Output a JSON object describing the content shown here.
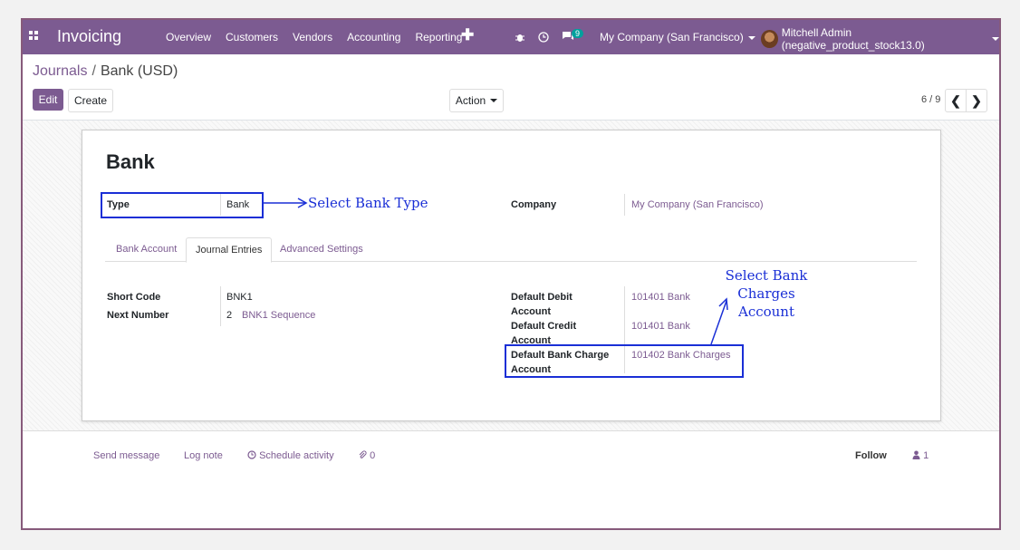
{
  "navbar": {
    "brand": "Invoicing",
    "menu": [
      "Overview",
      "Customers",
      "Vendors",
      "Accounting",
      "Reporting"
    ],
    "plus": "✚",
    "chat_badge": "9",
    "company": "My Company (San Francisco)",
    "user": "Mitchell Admin (negative_product_stock13.0)"
  },
  "control_panel": {
    "breadcrumb_parent": "Journals",
    "breadcrumb_sep": "/",
    "breadcrumb_current": "Bank (USD)",
    "edit_label": "Edit",
    "create_label": "Create",
    "action_label": "Action",
    "pager": "6 / 9",
    "prev_icon": "❮",
    "next_icon": "❯"
  },
  "form": {
    "title": "Bank",
    "type_label": "Type",
    "type_value": "Bank",
    "company_label": "Company",
    "company_value": "My Company (San Francisco)",
    "tabs": [
      "Bank Account",
      "Journal Entries",
      "Advanced Settings"
    ],
    "short_code_label": "Short Code",
    "short_code_value": "BNK1",
    "next_number_label": "Next Number",
    "next_number_value": "2",
    "sequence_link": "BNK1 Sequence",
    "debit_label_1": "Default Debit",
    "debit_label_2": "Account",
    "debit_value": "101401 Bank",
    "credit_label_1": "Default Credit",
    "credit_label_2": "Account",
    "credit_value": "101401 Bank",
    "charge_label_1": "Default Bank Charge",
    "charge_label_2": "Account",
    "charge_value": "101402 Bank Charges"
  },
  "annotations": {
    "type_note": "Select Bank Type",
    "charges_note_1": "Select Bank Charges",
    "charges_note_2": "Account",
    "color": "#1a2fd6"
  },
  "chatter": {
    "send_message": "Send message",
    "log_note": "Log note",
    "schedule_activity": "Schedule activity",
    "attachments": "0",
    "follow": "Follow",
    "followers": "1"
  },
  "colors": {
    "brand": "#7c5b91",
    "frame": "#875a7b"
  }
}
